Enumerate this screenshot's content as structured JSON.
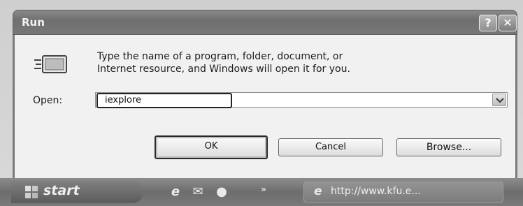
{
  "window": {
    "title": "Run",
    "help_label": "?",
    "close_label": "✕",
    "icon": "run-program-icon"
  },
  "dialog": {
    "description_line1": "Type the name of a program, folder, document, or",
    "description_line2": "Internet resource, and Windows will open it for you.",
    "open_label": "Open:",
    "open_value": "iexplore",
    "ok_label": "OK",
    "cancel_label": "Cancel",
    "browse_label": "Browse..."
  },
  "taskbar": {
    "start_label": "start",
    "quick_launch": [
      "ie-icon",
      "outlook-icon",
      "media-player-icon"
    ],
    "more_label": "»",
    "task_item_label": "http://www.kfu.e..."
  }
}
